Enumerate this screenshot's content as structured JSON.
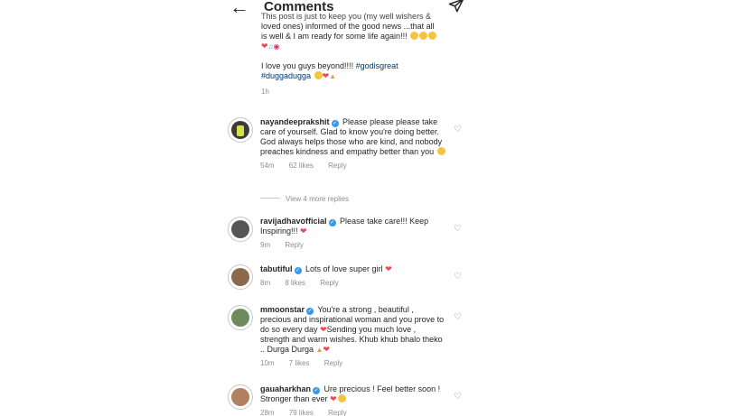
{
  "header": {
    "title": "Comments"
  },
  "caption": {
    "cut_line": "This post is just to keep you (my well wishers &",
    "lines": [
      "loved ones) informed of the good news ...that all",
      "is well & I am ready for some life again!!!"
    ],
    "love_line": "I love you guys beyond!!!!",
    "tag1": "#godisgreat",
    "tag2": "#duggadugga",
    "time": "1h"
  },
  "comments": [
    {
      "username": "nayandeeprakshit",
      "text": "Please please please take care of yourself.  Glad to know you're doing better. God always helps those who are kind, and nobody preaches kindness and empathy better than you",
      "time": "54m",
      "likes": "62 likes",
      "reply": "Reply"
    },
    {
      "username": "ravijadhavofficial",
      "text": "Please take care!!! Keep Inspiring!!!",
      "time": "9m",
      "likes": "",
      "reply": "Reply"
    },
    {
      "username": "tabutiful",
      "text": "Lots of love super girl",
      "time": "8m",
      "likes": "8 likes",
      "reply": "Reply"
    },
    {
      "username": "mmoonstar",
      "text": "You're a strong , beautiful , precious and inspirational woman and you prove to do so every day",
      "text2": "Sending you much love , strength and warm wishes. Khub khub bhalo theko .. Durga Durga",
      "time": "10m",
      "likes": "7 likes",
      "reply": "Reply"
    },
    {
      "username": "gauaharkhan",
      "text": "Ure precious ! Feel better soon ! Stronger than ever",
      "time": "28m",
      "likes": "79 likes",
      "reply": "Reply"
    }
  ],
  "view_more": "View 4 more replies",
  "icons": {
    "back": "back-arrow-icon",
    "send": "paper-plane-icon",
    "like": "heart-outline-icon",
    "verified": "verified-badge-icon"
  },
  "colors": {
    "verified": "#3897f0",
    "hashtag": "#00376b",
    "heart": "#ed4956",
    "meta": "#8e8e8e"
  }
}
